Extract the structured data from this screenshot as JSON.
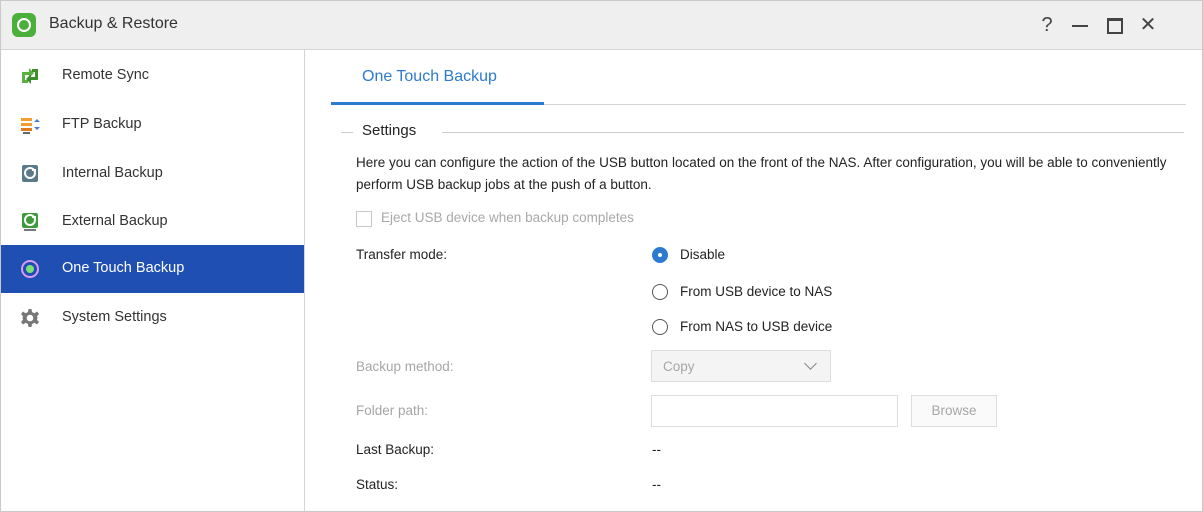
{
  "window": {
    "title": "Backup & Restore",
    "controls": {
      "help": "?",
      "close": "✕"
    }
  },
  "sidebar": {
    "items": [
      {
        "label": "Remote Sync",
        "icon": "remote-sync-icon",
        "active": false
      },
      {
        "label": "FTP Backup",
        "icon": "ftp-backup-icon",
        "active": false
      },
      {
        "label": "Internal Backup",
        "icon": "internal-backup-icon",
        "active": false
      },
      {
        "label": "External Backup",
        "icon": "external-backup-icon",
        "active": false
      },
      {
        "label": "One Touch Backup",
        "icon": "one-touch-backup-icon",
        "active": true
      },
      {
        "label": "System Settings",
        "icon": "gear-icon",
        "active": false
      }
    ]
  },
  "main": {
    "tabs": [
      {
        "label": "One Touch Backup",
        "active": true
      }
    ],
    "settings": {
      "title": "Settings",
      "description": "Here you can configure the action of the USB button located on the front of the NAS. After configuration, you will be able to conveniently perform USB backup jobs at the push of a button.",
      "eject_label": "Eject USB device when backup completes",
      "eject_checked": false,
      "transfer_mode_label": "Transfer mode:",
      "transfer_modes": [
        {
          "label": "Disable",
          "checked": true
        },
        {
          "label": "From USB device to NAS",
          "checked": false
        },
        {
          "label": "From NAS to USB device",
          "checked": false
        }
      ],
      "backup_method_label": "Backup method:",
      "backup_method_value": "Copy",
      "folder_path_label": "Folder path:",
      "folder_path_value": "",
      "browse_label": "Browse",
      "last_backup_label": "Last Backup:",
      "last_backup_value": "--",
      "status_label": "Status:",
      "status_value": "--"
    }
  },
  "colors": {
    "accent": "#2d7bd0",
    "sidebar_active": "#1f4fb3",
    "app_icon": "#4caf3c",
    "disabled_text": "#a6a6a6"
  }
}
